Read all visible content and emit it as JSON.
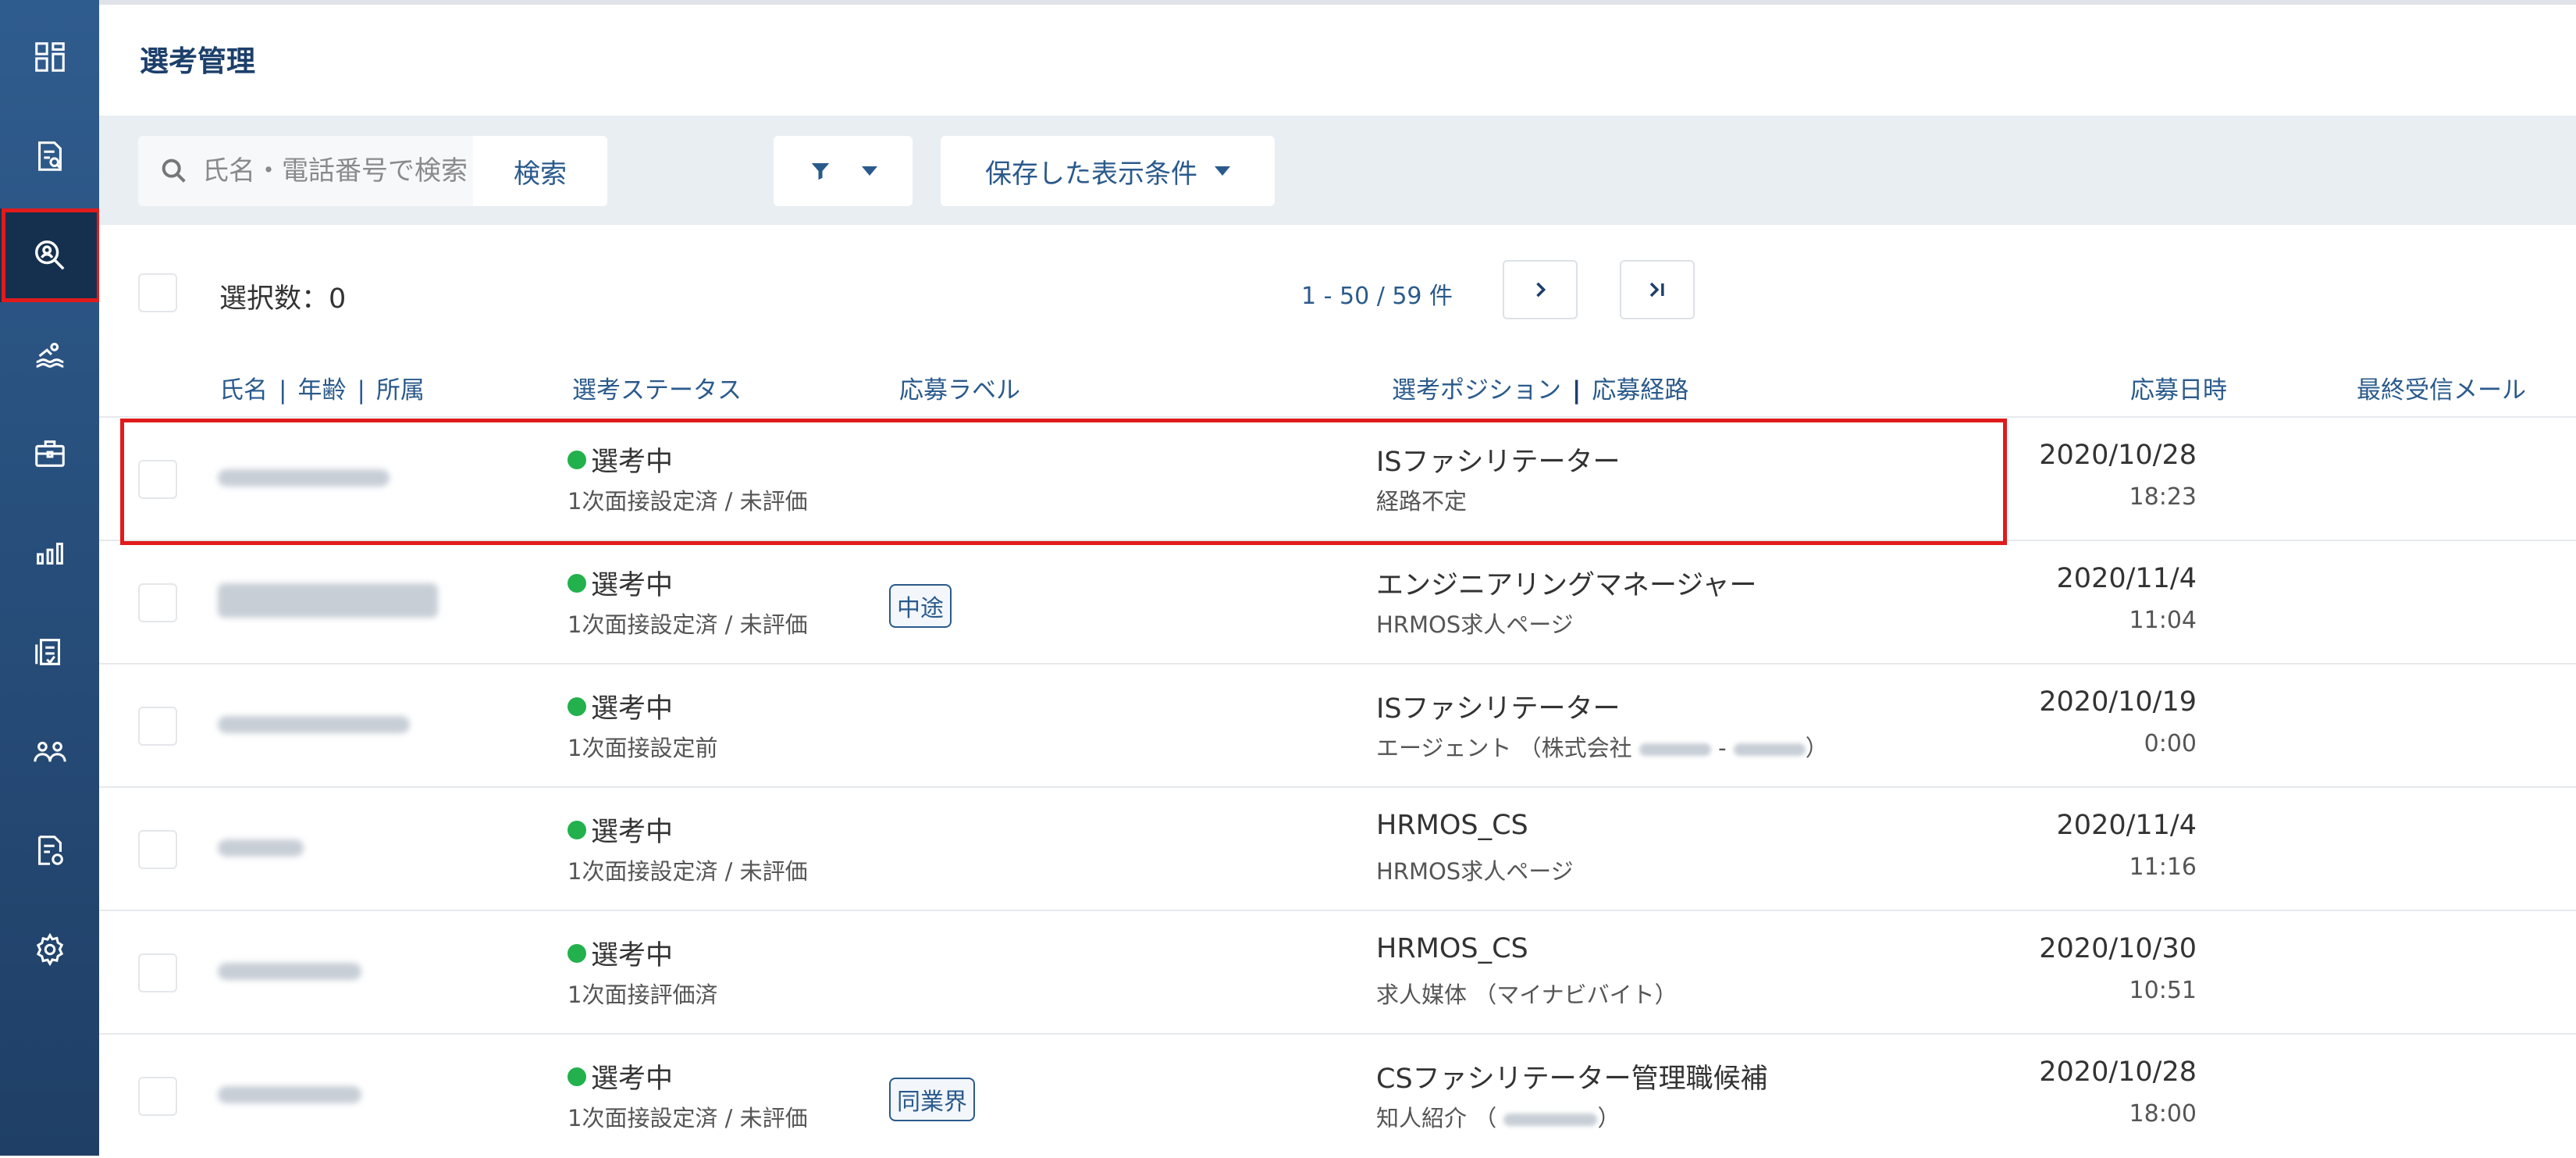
{
  "page_title": "選考管理",
  "search": {
    "placeholder": "氏名・電話番号で検索",
    "button_label": "検索"
  },
  "saved_conditions_label": "保存した表示条件",
  "selection_count": "選択数：0",
  "pagination": {
    "range": "1 - 50 / 59 件"
  },
  "columns": {
    "name": "氏名",
    "age": "年齢",
    "affiliation": "所属",
    "status": "選考ステータス",
    "label": "応募ラベル",
    "position": "選考ポジション",
    "route": "応募経路",
    "applied_at": "応募日時",
    "last_mail": "最終受信メール"
  },
  "rows": [
    {
      "status": "選考中",
      "substatus": "1次面接設定済 / 未評価",
      "label": "",
      "position": "ISファシリテーター",
      "route": "経路不定",
      "date": "2020/10/28",
      "time": "18:23"
    },
    {
      "status": "選考中",
      "substatus": "1次面接設定済 / 未評価",
      "label": "中途",
      "position": "エンジニアリングマネージャー",
      "route": "HRMOS求人ページ",
      "date": "2020/11/4",
      "time": "11:04"
    },
    {
      "status": "選考中",
      "substatus": "1次面接設定前",
      "label": "",
      "position": "ISファシリテーター",
      "route_prefix": "エージェント （株式会社",
      "route_mid": "-",
      "route_suffix": "）",
      "date": "2020/10/19",
      "time": "0:00"
    },
    {
      "status": "選考中",
      "substatus": "1次面接設定済 / 未評価",
      "label": "",
      "position": "HRMOS_CS",
      "route": "HRMOS求人ページ",
      "date": "2020/11/4",
      "time": "11:16"
    },
    {
      "status": "選考中",
      "substatus": "1次面接評価済",
      "label": "",
      "position": "HRMOS_CS",
      "route": "求人媒体 （マイナビバイト）",
      "date": "2020/10/30",
      "time": "10:51"
    },
    {
      "status": "選考中",
      "substatus": "1次面接設定済 / 未評価",
      "label": "同業界",
      "position": "CSファシリテーター管理職候補",
      "route_prefix": "知人紹介 （",
      "route_suffix": "）",
      "date": "2020/10/28",
      "time": "18:00"
    }
  ],
  "colors": {
    "sidebar": "#2a5686",
    "accent": "#2a5a8c",
    "status_dot": "#22b14c",
    "highlight": "#e11b1b"
  }
}
